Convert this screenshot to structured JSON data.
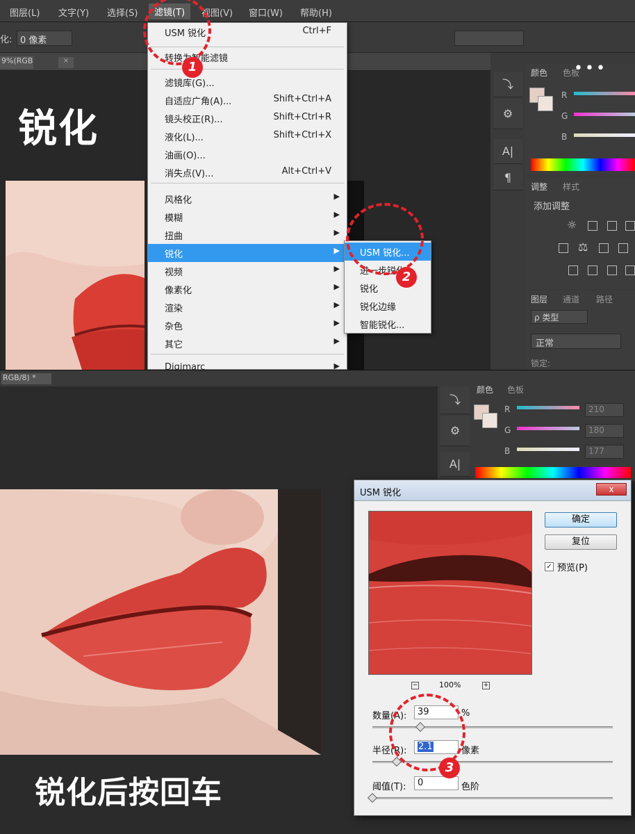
{
  "menubar": {
    "items": [
      "图层(L)",
      "文字(Y)",
      "选择(S)",
      "滤镜(T)",
      "视图(V)",
      "窗口(W)",
      "帮助(H)"
    ]
  },
  "options_bar": {
    "label": "化:",
    "value": "0 像素"
  },
  "tab_top": {
    "label": "9%(RGB"
  },
  "heading_top": "锐化",
  "more_icon": "•••",
  "filter_menu": {
    "items": [
      {
        "label": "USM 锐化",
        "shortcut": "Ctrl+F"
      },
      {
        "label": "转换为智能滤镜",
        "shortcut": ""
      },
      {
        "label": "滤镜库(G)...",
        "shortcut": ""
      },
      {
        "label": "自适应广角(A)...",
        "shortcut": "Shift+Ctrl+A"
      },
      {
        "label": "镜头校正(R)...",
        "shortcut": "Shift+Ctrl+R"
      },
      {
        "label": "液化(L)...",
        "shortcut": "Shift+Ctrl+X"
      },
      {
        "label": "油画(O)...",
        "shortcut": ""
      },
      {
        "label": "消失点(V)...",
        "shortcut": "Alt+Ctrl+V"
      },
      {
        "label": "风格化",
        "shortcut": ""
      },
      {
        "label": "模糊",
        "shortcut": ""
      },
      {
        "label": "扭曲",
        "shortcut": ""
      },
      {
        "label": "锐化",
        "shortcut": ""
      },
      {
        "label": "视频",
        "shortcut": ""
      },
      {
        "label": "像素化",
        "shortcut": ""
      },
      {
        "label": "渲染",
        "shortcut": ""
      },
      {
        "label": "杂色",
        "shortcut": ""
      },
      {
        "label": "其它",
        "shortcut": ""
      },
      {
        "label": "Digimarc",
        "shortcut": ""
      }
    ]
  },
  "sharpen_submenu": {
    "items": [
      "USM 锐化...",
      "进一步锐化",
      "锐化",
      "锐化边缘",
      "智能锐化..."
    ]
  },
  "right_panel_top": {
    "color_tabs": [
      "颜色",
      "色板"
    ],
    "channels": [
      "R",
      "G",
      "B"
    ],
    "adjust_tabs": [
      "调整",
      "样式"
    ],
    "adjust_title": "添加调整",
    "layer_tabs": [
      "图层",
      "通道",
      "路径"
    ],
    "layer_kind": "ρ 类型",
    "blend_mode": "正常",
    "lock_label": "锁定:"
  },
  "tab_bottom": {
    "label": "RGB/8) *"
  },
  "right_panel_bottom": {
    "color_tabs": [
      "颜色",
      "色板"
    ],
    "channels": [
      "R",
      "G",
      "B"
    ],
    "values": [
      "210",
      "180",
      "177"
    ]
  },
  "usm_dialog": {
    "title": "USM 锐化",
    "close_label": "x",
    "ok_label": "确定",
    "reset_label": "复位",
    "preview_label": "预览(P)",
    "zoom": "100%",
    "amount_label": "数量(A):",
    "amount_value": "39",
    "amount_unit": "%",
    "radius_label": "半径(R):",
    "radius_value": "2.1",
    "radius_unit": "像素",
    "threshold_label": "阈值(T):",
    "threshold_value": "0",
    "threshold_unit": "色阶",
    "amount_fraction": 0.2,
    "radius_fraction": 0.1,
    "threshold_fraction": 0.0
  },
  "heading_bottom": "锐化后按回车",
  "annotations": [
    "1",
    "2",
    "3"
  ],
  "colors": {
    "accent": "#3399ee",
    "annotation": "#e3222b",
    "lip": "#d9453a"
  }
}
